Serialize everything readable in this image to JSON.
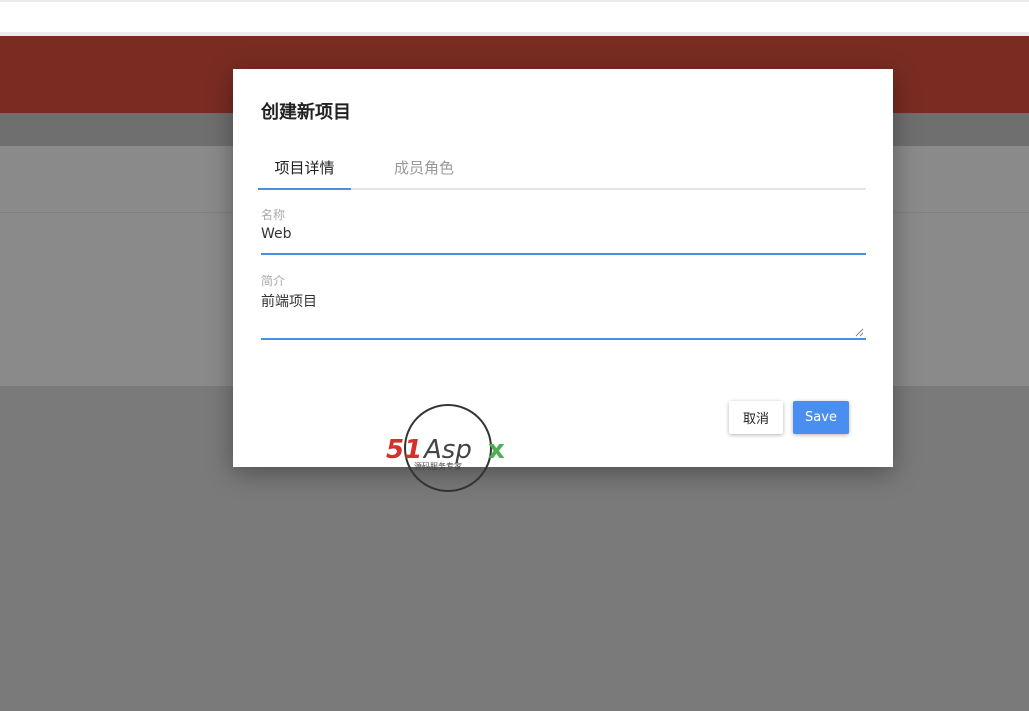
{
  "dialog": {
    "title": "创建新项目",
    "tabs": [
      {
        "label": "项目详情",
        "active": true
      },
      {
        "label": "成员角色",
        "active": false
      }
    ],
    "fields": {
      "name": {
        "label": "名称",
        "value": "Web"
      },
      "description": {
        "label": "简介",
        "value": "前端项目"
      }
    },
    "actions": {
      "cancel_label": "取消",
      "save_label": "Save"
    }
  },
  "watermark": {
    "brand": "51Aspx",
    "tagline": "源码服务专家"
  },
  "colors": {
    "header_bar": "#7a2c22",
    "accent": "#4a90e2",
    "save_button": "#4a8ff0",
    "overlay": "#7a7a7a"
  }
}
